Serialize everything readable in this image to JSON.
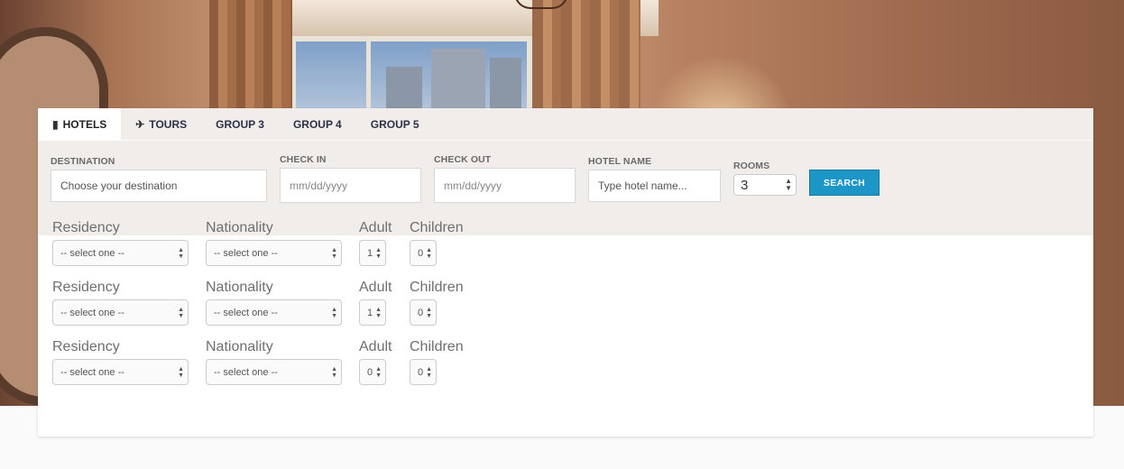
{
  "tabs": [
    {
      "label": "HOTELS",
      "icon": "building-icon"
    },
    {
      "label": "TOURS",
      "icon": "plane-icon"
    },
    {
      "label": "GROUP 3"
    },
    {
      "label": "GROUP 4"
    },
    {
      "label": "GROUP 5"
    }
  ],
  "search": {
    "destination_label": "DESTINATION",
    "destination_placeholder": "Choose your destination",
    "checkin_label": "CHECK IN",
    "checkin_placeholder": "mm/dd/yyyy",
    "checkout_label": "CHECK OUT",
    "checkout_placeholder": "mm/dd/yyyy",
    "hotel_label": "HOTEL NAME",
    "hotel_placeholder": "Type hotel name...",
    "rooms_label": "ROOMS",
    "rooms_value": "3",
    "button": "SEARCH"
  },
  "room_labels": {
    "residency": "Residency",
    "nationality": "Nationality",
    "adult": "Adult",
    "children": "Children"
  },
  "rooms": [
    {
      "residency": "-- select one --",
      "nationality": "-- select one --",
      "adult": "1",
      "children": "0"
    },
    {
      "residency": "-- select one --",
      "nationality": "-- select one --",
      "adult": "1",
      "children": "0"
    },
    {
      "residency": "-- select one --",
      "nationality": "-- select one --",
      "adult": "0",
      "children": "0"
    }
  ],
  "colors": {
    "accent": "#1b96c6",
    "tab_text": "#2c3149"
  }
}
